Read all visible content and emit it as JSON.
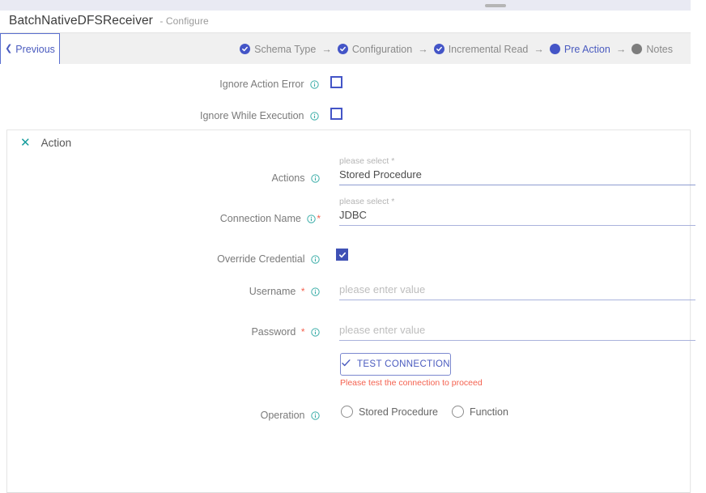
{
  "window": {
    "drag_handle": "drag-handle"
  },
  "header": {
    "title": "BatchNativeDFSReceiver",
    "subtitle": "- Configure"
  },
  "wizard": {
    "previous_label": "Previous",
    "arrow": "→",
    "steps": [
      {
        "label": "Schema Type",
        "state": "done"
      },
      {
        "label": "Configuration",
        "state": "done"
      },
      {
        "label": "Incremental Read",
        "state": "done"
      },
      {
        "label": "Pre Action",
        "state": "active"
      },
      {
        "label": "Notes",
        "state": "todo"
      }
    ],
    "colors": {
      "done": "#4455c7",
      "active": "#4455c7",
      "todo": "#7d7d7d",
      "active_text": "#4a5bbf",
      "inactive_text": "#8a8a8a"
    }
  },
  "top_options": [
    {
      "label": "Ignore Action Error",
      "checked": false
    },
    {
      "label": "Ignore While Execution",
      "checked": false
    }
  ],
  "action_card": {
    "title": "Action",
    "close_icon": "close-x-icon",
    "fields": {
      "actions": {
        "label": "Actions",
        "required": false,
        "float_label": "please select *",
        "value": "Stored Procedure"
      },
      "connection_name": {
        "label": "Connection Name",
        "required": true,
        "required_mark": "*",
        "float_label": "please select *",
        "value": "JDBC"
      },
      "override_credential": {
        "label": "Override Credential",
        "checked": true
      },
      "username": {
        "label": "Username",
        "required": true,
        "required_mark": "*",
        "placeholder": "please enter value",
        "value": ""
      },
      "password": {
        "label": "Password",
        "required": true,
        "required_mark": "*",
        "placeholder": "please enter value",
        "value": ""
      },
      "operation": {
        "label": "Operation",
        "options": [
          {
            "label": "Stored Procedure",
            "selected": false
          },
          {
            "label": "Function",
            "selected": false
          }
        ]
      }
    },
    "test_connection": {
      "label": "TEST CONNECTION",
      "icon": "check-icon",
      "warning": "Please test the connection to proceed",
      "warning_color": "#f4614f"
    }
  },
  "colors": {
    "accent_blue": "#4455c7",
    "teal_icon": "#169c9c",
    "checkbox_checked": "#3f51b5",
    "underline": "#8e9cd1",
    "error_red": "#f4614f",
    "stepbar_bg": "#f0f0f0",
    "topstrip_bg": "#e9eaf3"
  }
}
